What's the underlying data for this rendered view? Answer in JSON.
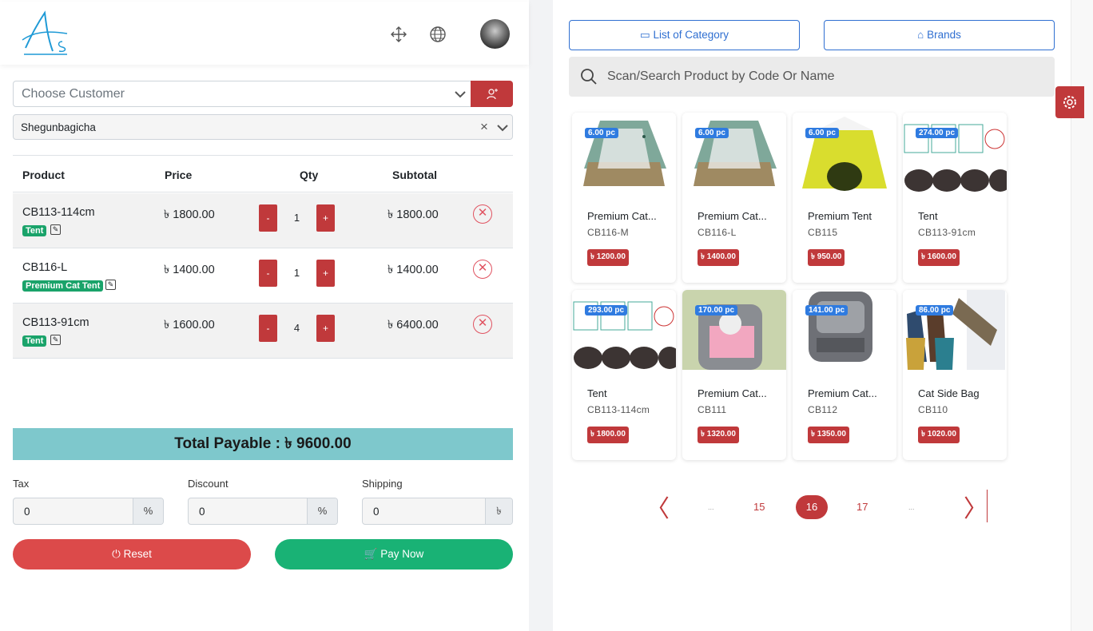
{
  "header": {
    "logo_text": "As",
    "icons": [
      "fullscreen-icon",
      "globe-icon"
    ],
    "avatar": "user-avatar"
  },
  "customer": {
    "placeholder": "Choose Customer",
    "warehouse": "Shegunbagicha"
  },
  "table": {
    "headers": [
      "Product",
      "Price",
      "Qty",
      "Subtotal"
    ],
    "rows": [
      {
        "name": "CB113-114cm",
        "tag": "Tent",
        "price": "৳ 1800.00",
        "qty": "1",
        "subtotal": "৳ 1800.00"
      },
      {
        "name": "CB116-L",
        "tag": "Premium Cat Tent",
        "price": "৳ 1400.00",
        "qty": "1",
        "subtotal": "৳ 1400.00"
      },
      {
        "name": "CB113-91cm",
        "tag": "Tent",
        "price": "৳ 1600.00",
        "qty": "4",
        "subtotal": "৳ 6400.00"
      }
    ],
    "minus": "-",
    "plus": "+"
  },
  "total": "Total Payable : ৳ 9600.00",
  "fields": {
    "tax": {
      "label": "Tax",
      "value": "0",
      "suffix": "%"
    },
    "discount": {
      "label": "Discount",
      "value": "0",
      "suffix": "%"
    },
    "shipping": {
      "label": "Shipping",
      "value": "0",
      "suffix": "৳"
    }
  },
  "buttons": {
    "reset": "Reset",
    "pay": "Pay Now",
    "category": "List of Category",
    "brands": "Brands"
  },
  "search": {
    "placeholder": "Scan/Search Product by Code Or Name"
  },
  "products": [
    {
      "name": "Premium Cat...",
      "code": "CB116-M",
      "stock": "6.00 pc",
      "price": "৳ 1200.00",
      "img": "cat-tent-green"
    },
    {
      "name": "Premium Cat...",
      "code": "CB116-L",
      "stock": "6.00 pc",
      "price": "৳ 1400.00",
      "img": "cat-tent-green"
    },
    {
      "name": "Premium Tent",
      "code": "CB115",
      "stock": "6.00 pc",
      "price": "৳ 950.00",
      "img": "tent-yellow"
    },
    {
      "name": "Tent",
      "code": "CB113-91cm",
      "stock": "274.00 pc",
      "price": "৳ 1600.00",
      "img": "tent-measure"
    },
    {
      "name": "Tent",
      "code": "CB113-114cm",
      "stock": "293.00 pc",
      "price": "৳ 1800.00",
      "img": "tent-measure"
    },
    {
      "name": "Premium Cat...",
      "code": "CB111",
      "stock": "170.00 pc",
      "price": "৳ 1320.00",
      "img": "cat-backpack-pink"
    },
    {
      "name": "Premium Cat...",
      "code": "CB112",
      "stock": "141.00 pc",
      "price": "৳ 1350.00",
      "img": "cat-backpack-grey"
    },
    {
      "name": "Cat Side Bag",
      "code": "CB110",
      "stock": "86.00 pc",
      "price": "৳ 1020.00",
      "img": "cat-side-bag"
    }
  ],
  "pagination": {
    "prev": "〈",
    "ellipsis": "...",
    "pages": [
      "15",
      "16",
      "17"
    ],
    "current": "16",
    "next": "〉"
  },
  "colors": {
    "accent": "#c0393b",
    "green": "#1aa36a",
    "blue": "#2f6fd1",
    "total_bg": "#7ec8cc"
  }
}
